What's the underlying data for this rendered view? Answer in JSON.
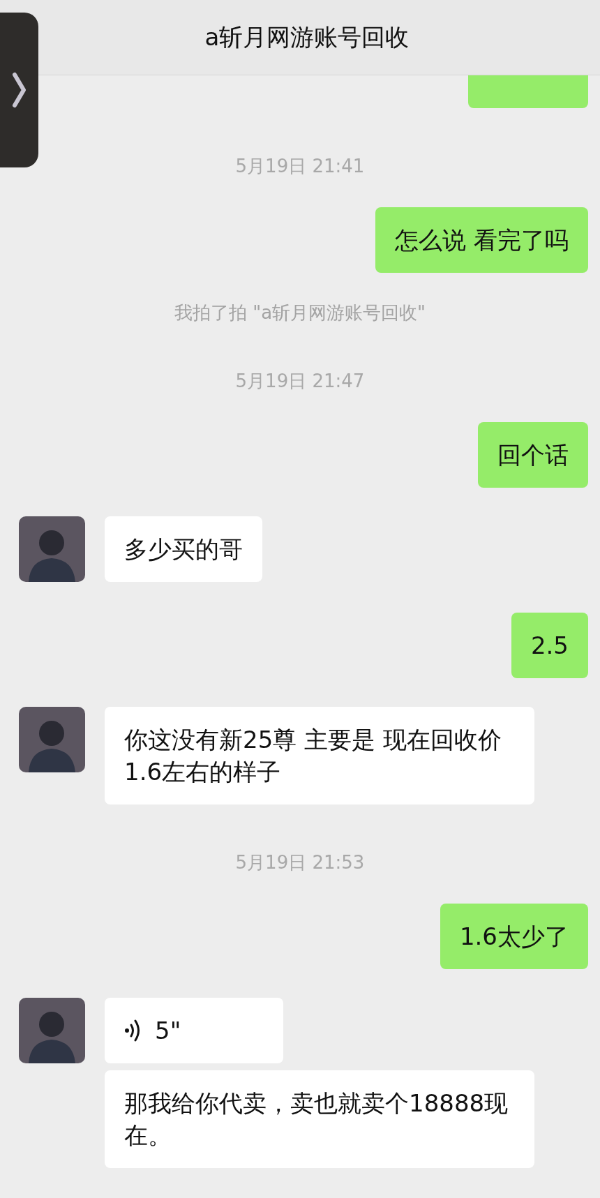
{
  "header": {
    "title": "a斩月网游账号回收"
  },
  "messages": [
    {
      "kind": "clipped"
    },
    {
      "kind": "time",
      "text": "5月19日 21:41"
    },
    {
      "kind": "out",
      "text": "怎么说 看完了吗"
    },
    {
      "kind": "system",
      "text": "我拍了拍 \"a斩月网游账号回收\""
    },
    {
      "kind": "time",
      "text": "5月19日 21:47"
    },
    {
      "kind": "out",
      "text": "回个话"
    },
    {
      "kind": "in",
      "avatar": true,
      "text": "多少买的哥"
    },
    {
      "kind": "out",
      "text": "2.5"
    },
    {
      "kind": "in",
      "avatar": true,
      "text": "你这没有新25尊 主要是 现在回收价1.6左右的样子"
    },
    {
      "kind": "time",
      "text": "5月19日 21:53"
    },
    {
      "kind": "out",
      "text": "1.6太少了"
    },
    {
      "kind": "voice",
      "avatar": true,
      "text": "5\""
    },
    {
      "kind": "in",
      "avatar": false,
      "text": "那我给你代卖，卖也就卖个18888现在。"
    }
  ]
}
